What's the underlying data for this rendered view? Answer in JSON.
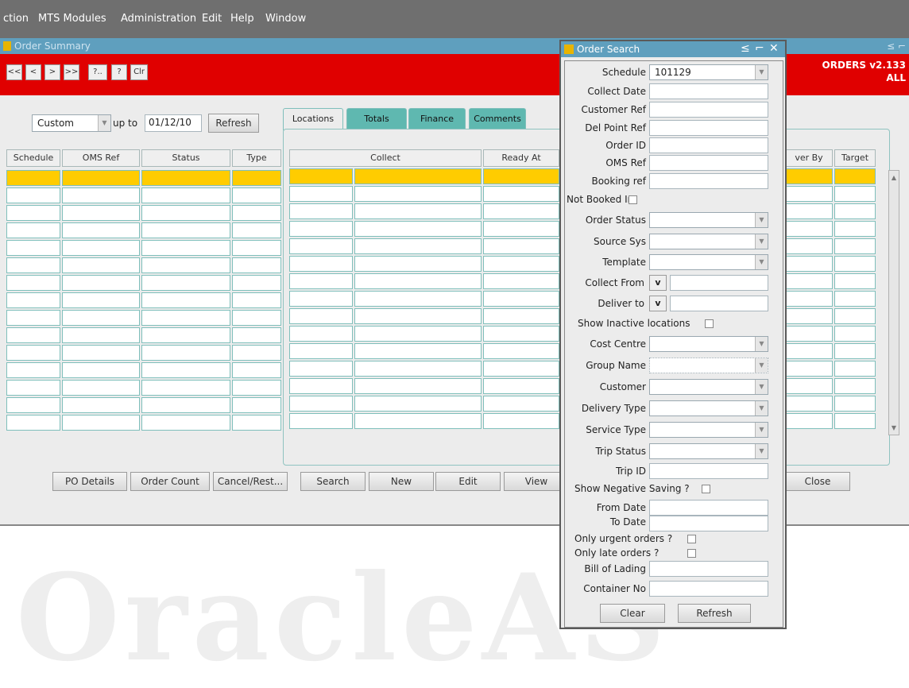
{
  "menu": [
    "ction",
    "MTS Modules",
    "Administration",
    "Edit",
    "Help",
    "Window"
  ],
  "main": {
    "title": "Order Summary",
    "window_controls": "≤ ⌐",
    "toolbar": [
      "<<",
      "<",
      ">",
      ">>",
      "?..",
      "?",
      "Clr"
    ],
    "version": "ORDERS v2.133",
    "scope": "ALL",
    "range_mode": "Custom",
    "up_to_label": "up to",
    "up_to_date": "01/12/10",
    "refresh": "Refresh",
    "left_columns": [
      "Schedule",
      "OMS Ref",
      "Status",
      "Type"
    ],
    "tabs": [
      "Locations",
      "Totals",
      "Finance",
      "Comments"
    ],
    "mid_columns": [
      "Collect",
      "Ready At"
    ],
    "right_columns": [
      "ver By",
      "Target"
    ],
    "buttons": [
      "PO Details",
      "Order Count",
      "Cancel/Rest...",
      "Search",
      "New",
      "Edit",
      "View",
      "Close"
    ]
  },
  "watermark": "OracleAS",
  "dialog": {
    "title": "Order Search",
    "schedule_label": "Schedule",
    "schedule_value": "101129",
    "collect_date": "Collect Date",
    "customer_ref": "Customer Ref",
    "del_point_ref": "Del Point Ref",
    "order_id": "Order ID",
    "oms_ref": "OMS Ref",
    "booking_ref": "Booking ref",
    "not_booked_in": "Not Booked In",
    "order_status": "Order Status",
    "source_sys": "Source Sys",
    "template": "Template",
    "collect_from": "Collect From",
    "deliver_to": "Deliver to",
    "v": "v",
    "show_inactive": "Show Inactive locations",
    "cost_centre": "Cost Centre",
    "group_name": "Group Name",
    "customer": "Customer",
    "delivery_type": "Delivery Type",
    "service_type": "Service Type",
    "trip_status": "Trip Status",
    "trip_id": "Trip ID",
    "show_negative": "Show Negative Saving ?",
    "from_date": "From Date",
    "to_date": "To Date",
    "only_urgent": "Only urgent orders ?",
    "only_late": "Only late orders ?",
    "bill_of_lading": "Bill of Lading",
    "container_no": "Container No",
    "clear": "Clear",
    "refresh": "Refresh"
  }
}
